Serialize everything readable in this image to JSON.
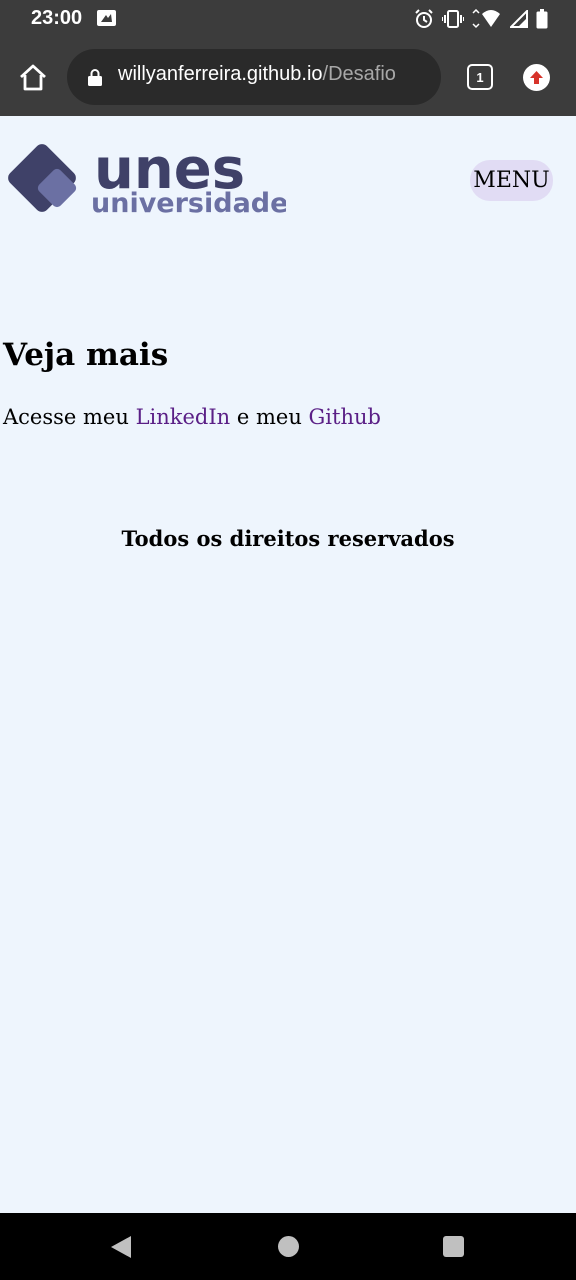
{
  "status_bar": {
    "time": "23:00",
    "icons": [
      "notification-icon",
      "alarm-icon",
      "vibrate-icon",
      "wifi-icon",
      "signal-icon",
      "battery-icon"
    ]
  },
  "browser": {
    "url_host": "willyanferreira.github.io",
    "url_path": "/Desafio",
    "tab_count": "1",
    "icons": [
      "home-icon",
      "lock-icon",
      "tab-switcher-icon",
      "update-icon"
    ]
  },
  "header": {
    "logo_text": "unes",
    "logo_subtext": "universidade",
    "menu_label": "MENU"
  },
  "main": {
    "heading": "Veja mais",
    "text_before": "Acesse meu",
    "link_linkedin": "LinkedIn",
    "text_middle": "e meu",
    "link_github": "Github"
  },
  "footer": {
    "text": "Todos os direitos reservados"
  },
  "colors": {
    "page_background": "#eef5fd",
    "link": "#5a1f86",
    "logo_dark": "#3f4168",
    "logo_light": "#6b70a3",
    "menu_background": "#e1dcf4",
    "browser_chrome": "#3c3c3c"
  }
}
